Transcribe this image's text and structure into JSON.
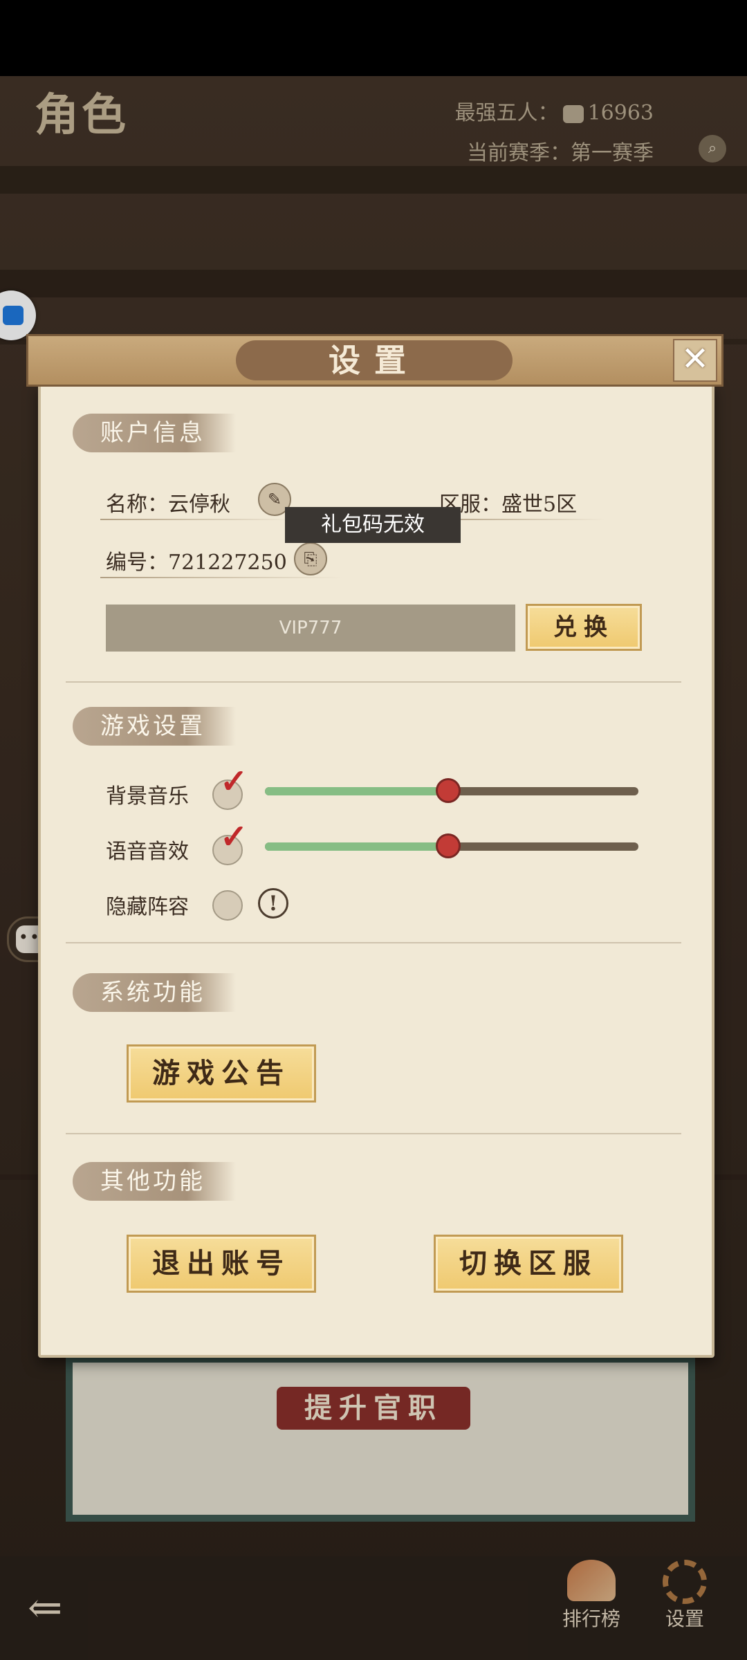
{
  "scene": {
    "title": "角色",
    "strongest_five_label": "最强五人：",
    "strongest_five_value": "16963",
    "season_label": "当前赛季：第一赛季",
    "promote_label": "提升官职",
    "chat_badge": "...",
    "chat_dots": "•••"
  },
  "dialog": {
    "title": "设置",
    "close": "✕",
    "account_section": "账户信息",
    "name_label": "名称：云停秋",
    "server_label": "区服：盛世5区",
    "id_label": "编号：721227250",
    "toast": "礼包码无效",
    "code_value": "VIP777",
    "redeem_button": "兑换",
    "game_section": "游戏设置",
    "bgm_label": "背景音乐",
    "bgm_level": 0.49,
    "voice_label": "语音音效",
    "voice_level": 0.49,
    "hide_lineup_label": "隐藏阵容",
    "system_section": "系统功能",
    "announcement_button": "游戏公告",
    "other_section": "其他功能",
    "logout_button": "退出账号",
    "switch_server_button": "切换区服",
    "checkmark": "✓",
    "info_mark": "!"
  },
  "bottom": {
    "back": "⇐",
    "rank_label": "排行榜",
    "settings_label": "设置"
  }
}
